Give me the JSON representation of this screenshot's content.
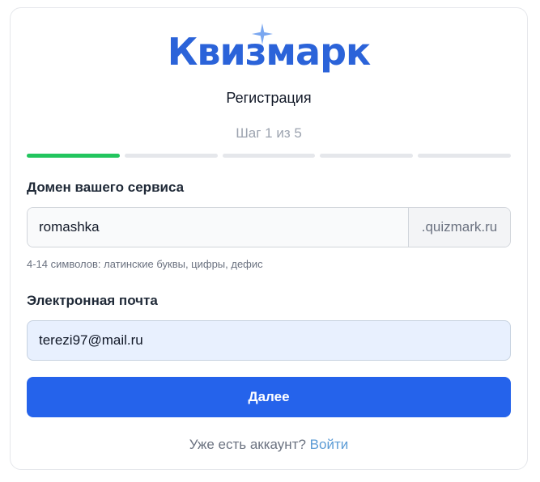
{
  "brand": {
    "logo_text": "Квизмарк",
    "logo_color": "#2b63d9",
    "star_color": "#7aa7f0"
  },
  "header": {
    "title": "Регистрация",
    "step_text": "Шаг 1 из 5"
  },
  "progress": {
    "total_steps": 5,
    "current_step": 1,
    "active_color": "#22c55e",
    "inactive_color": "#e5e7eb"
  },
  "domain_field": {
    "label": "Домен вашего сервиса",
    "value": "romashka",
    "suffix": ".quizmark.ru",
    "hint": "4-14 символов: латинские буквы, цифры, дефис"
  },
  "email_field": {
    "label": "Электронная почта",
    "value": "terezi97@mail.ru"
  },
  "actions": {
    "next_label": "Далее",
    "button_color": "#2563eb"
  },
  "footer": {
    "prompt": "Уже есть аккаунт?",
    "login_link": "Войти"
  }
}
